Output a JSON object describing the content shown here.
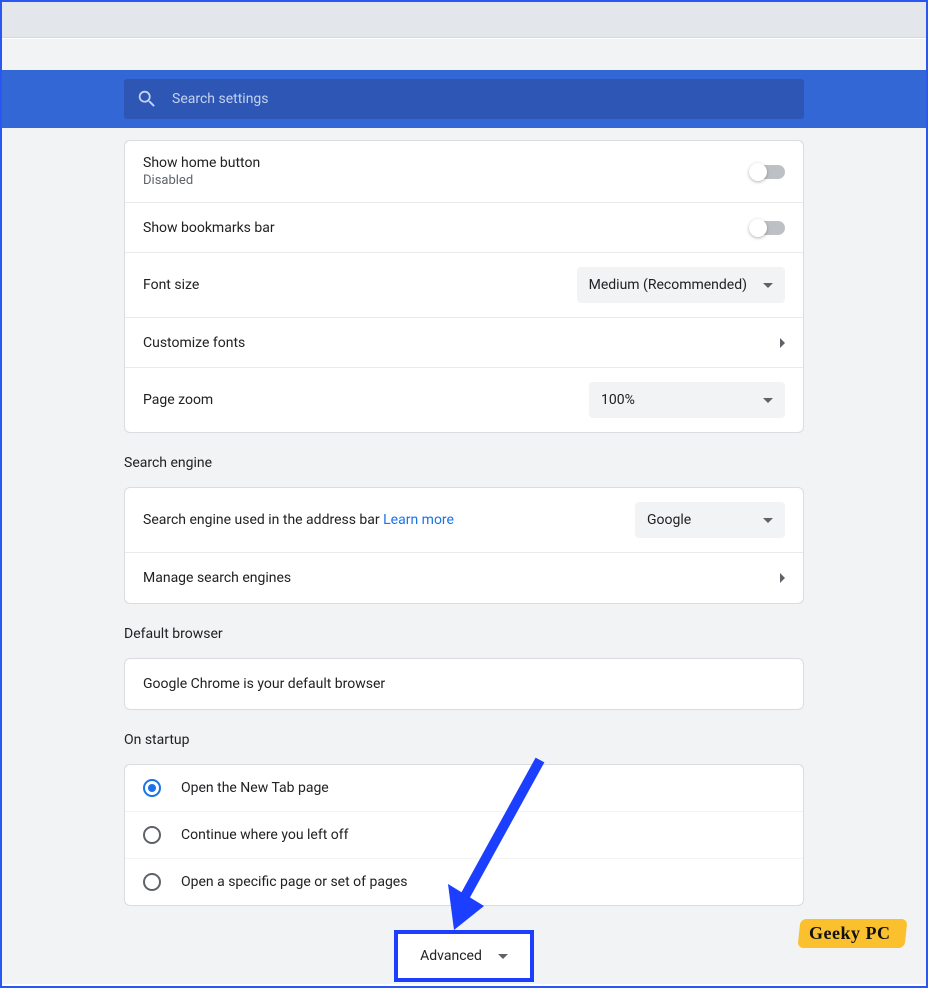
{
  "search": {
    "placeholder": "Search settings"
  },
  "appearance": {
    "show_home": {
      "title": "Show home button",
      "status": "Disabled"
    },
    "show_bookmarks": "Show bookmarks bar",
    "font_size": {
      "label": "Font size",
      "value": "Medium (Recommended)"
    },
    "customize_fonts": "Customize fonts",
    "page_zoom": {
      "label": "Page zoom",
      "value": "100%"
    }
  },
  "search_engine": {
    "title": "Search engine",
    "used_label": "Search engine used in the address bar",
    "learn_more": "Learn more",
    "value": "Google",
    "manage": "Manage search engines"
  },
  "default_browser": {
    "title": "Default browser",
    "status": "Google Chrome is your default browser"
  },
  "startup": {
    "title": "On startup",
    "options": [
      "Open the New Tab page",
      "Continue where you left off",
      "Open a specific page or set of pages"
    ],
    "selected": 0
  },
  "advanced": "Advanced",
  "watermark": "Geeky PC"
}
